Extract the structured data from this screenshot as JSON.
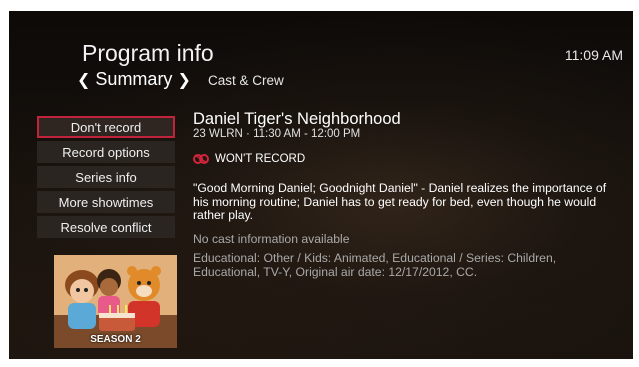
{
  "header": {
    "title": "Program info",
    "clock": "11:09 AM",
    "tabs": [
      {
        "label": "Summary",
        "active": true
      },
      {
        "label": "Cast & Crew",
        "active": false
      }
    ]
  },
  "menu": {
    "items": [
      {
        "label": "Don't record",
        "selected": true
      },
      {
        "label": "Record options",
        "selected": false
      },
      {
        "label": "Series info",
        "selected": false
      },
      {
        "label": "More showtimes",
        "selected": false
      },
      {
        "label": "Resolve conflict",
        "selected": false
      }
    ]
  },
  "program": {
    "title": "Daniel Tiger's Neighborhood",
    "channel_time": "23 WLRN · 11:30 AM - 12:00 PM",
    "record_status": "WON'T RECORD",
    "description": "\"Good Morning Daniel; Goodnight Daniel\" - Daniel realizes the importance of his morning routine; Daniel has to get ready for bed, even though he would rather play.",
    "cast": "No cast information available",
    "details": "Educational: Other / Kids: Animated, Educational / Series: Children, Educational, TV-Y, Original air date: 12/17/2012, CC."
  },
  "poster": {
    "season_label": "SEASON 2"
  },
  "icons": {
    "record_status_icon": "no-record-icon"
  },
  "colors": {
    "accent": "#c0233a",
    "text_primary": "#ffffff",
    "text_secondary": "#a9a9a9",
    "menu_bg": "#2d2824"
  }
}
